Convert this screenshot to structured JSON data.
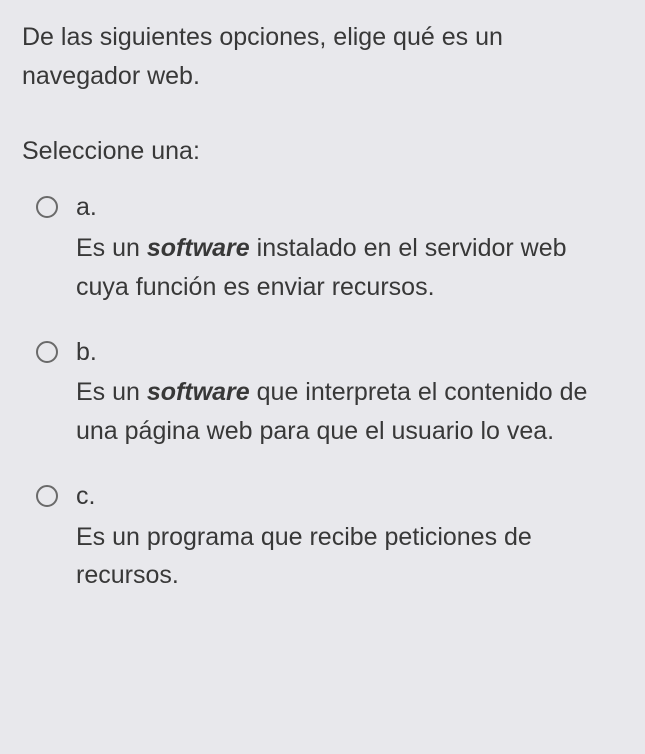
{
  "question": "De las siguientes opciones, elige qué es un navegador web.",
  "prompt": "Seleccione una:",
  "options": [
    {
      "label": "a.",
      "pre": "Es un ",
      "emph": "software",
      "post": " instalado en el servidor web cuya función es enviar recursos."
    },
    {
      "label": "b.",
      "pre": "Es un ",
      "emph": "software",
      "post": " que interpreta el contenido de una página web para que el usuario lo vea."
    },
    {
      "label": "c.",
      "pre": "",
      "emph": "",
      "post": "Es un programa que recibe peticiones de recursos."
    }
  ]
}
